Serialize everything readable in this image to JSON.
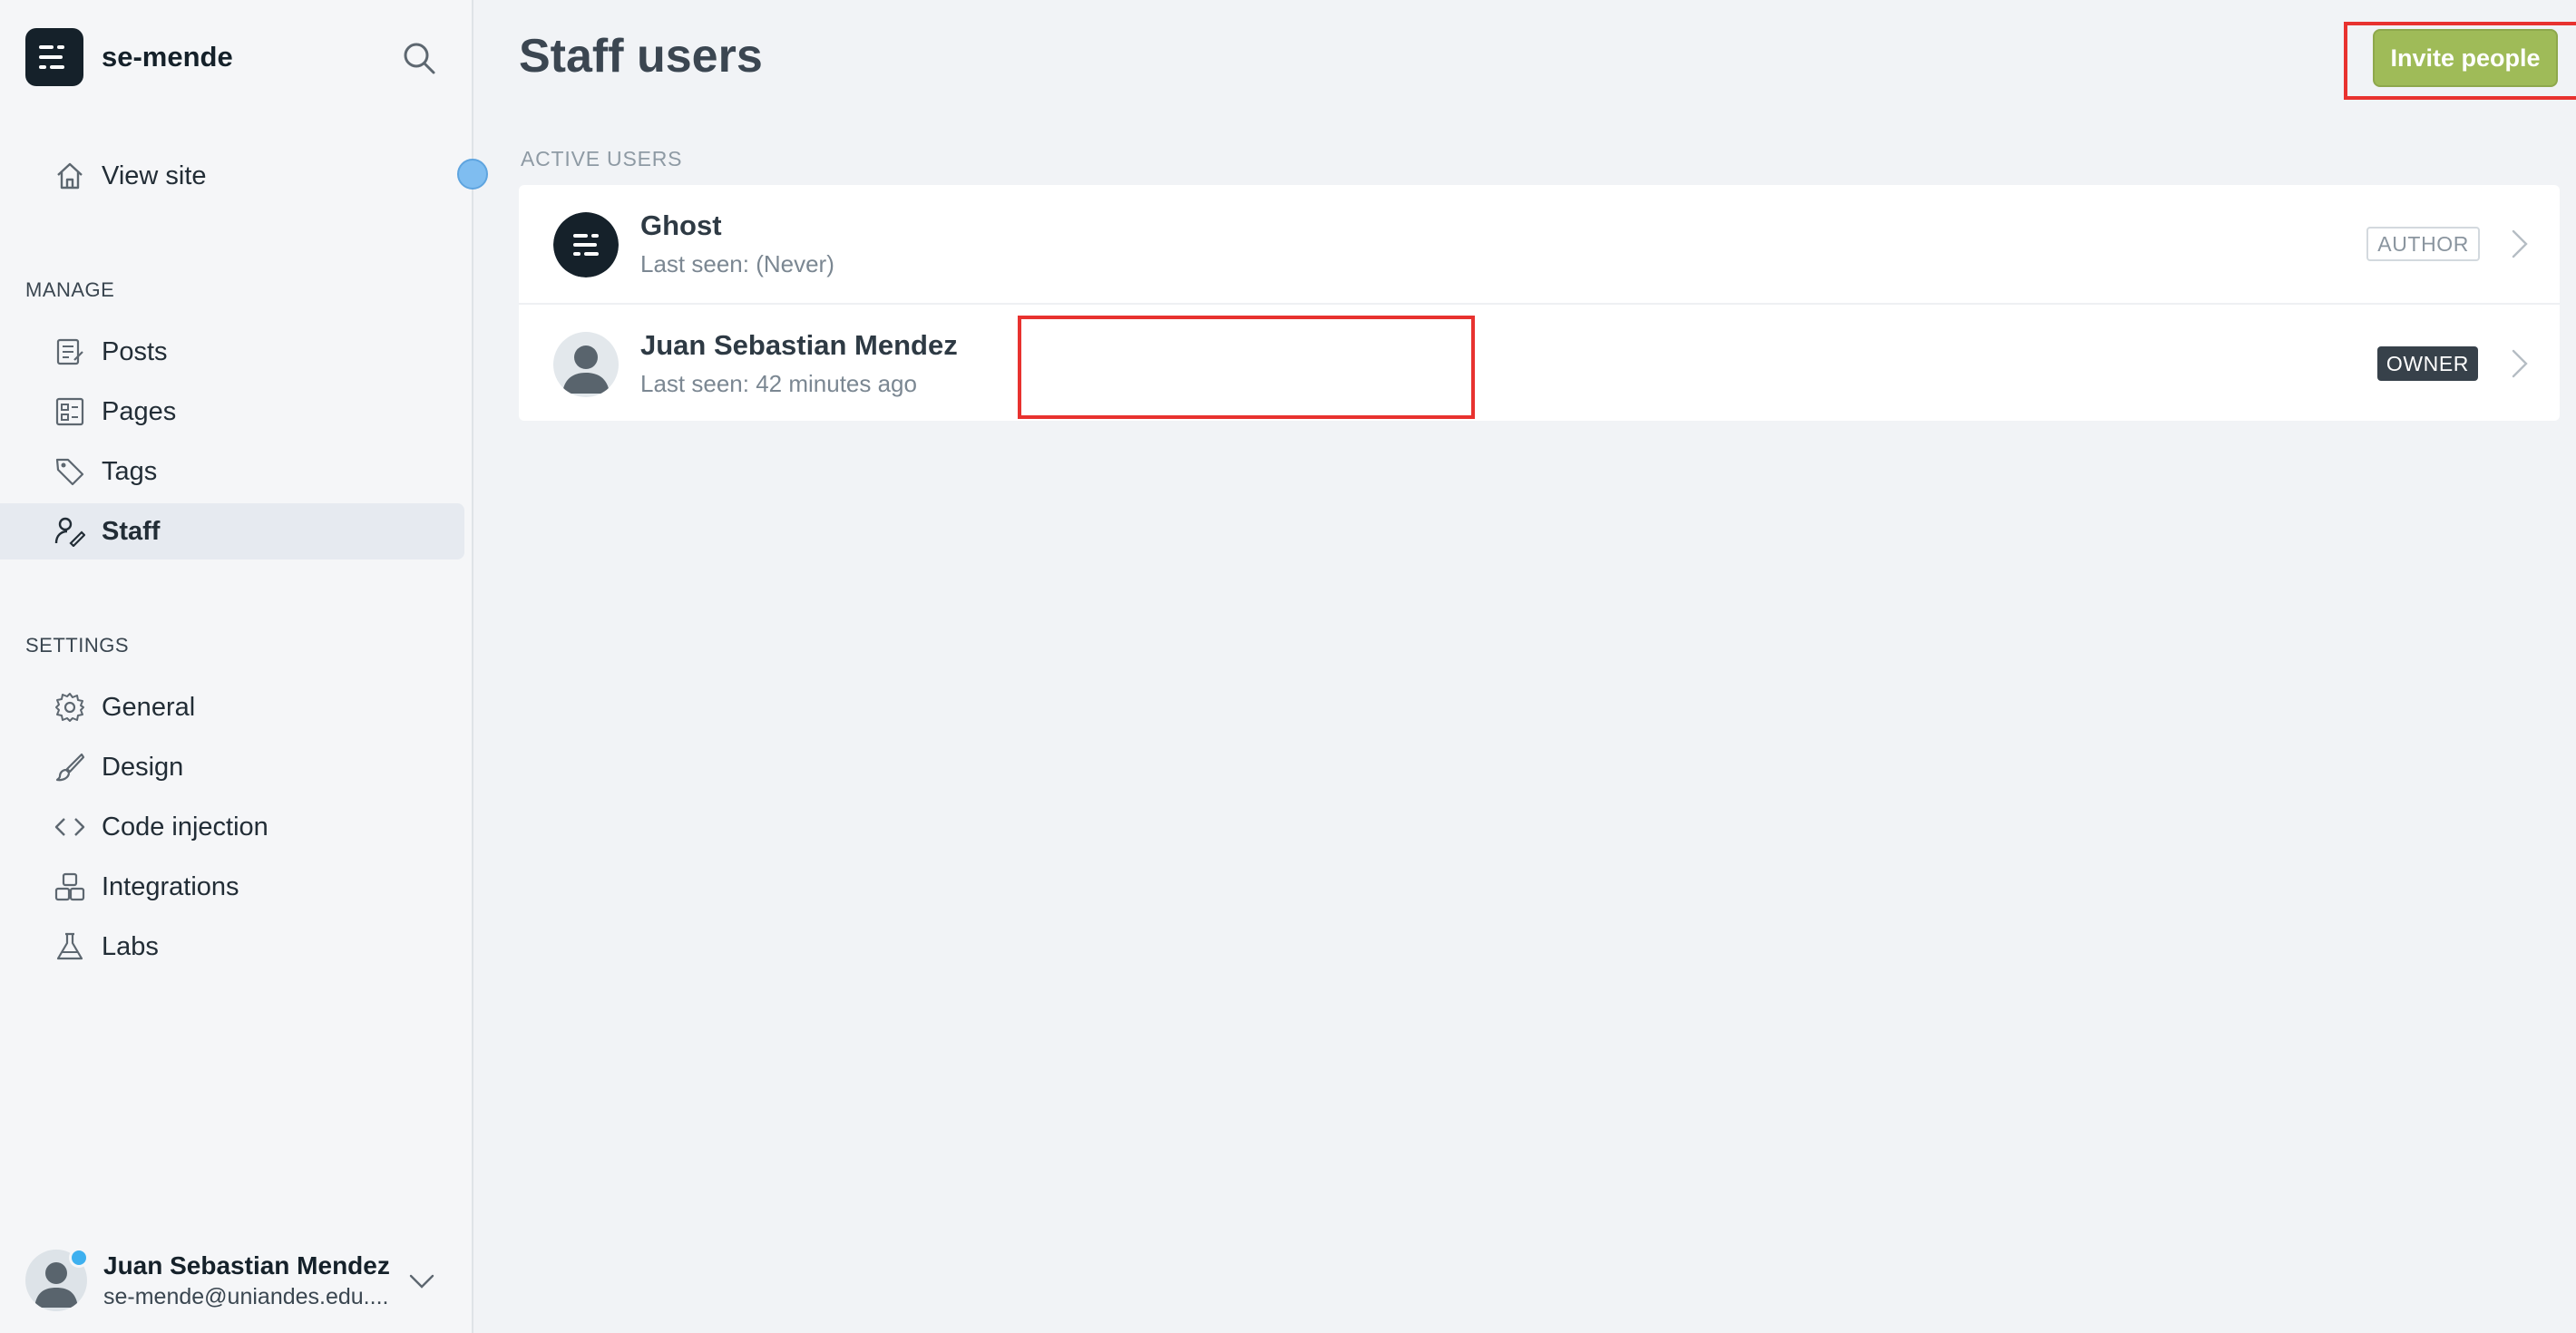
{
  "sidebar": {
    "brand_name": "se-mende",
    "view_site_label": "View site",
    "manage_title": "MANAGE",
    "manage_items": [
      {
        "label": "Posts",
        "icon": "posts-icon"
      },
      {
        "label": "Pages",
        "icon": "pages-icon"
      },
      {
        "label": "Tags",
        "icon": "tag-icon"
      },
      {
        "label": "Staff",
        "icon": "staff-icon",
        "active": true
      }
    ],
    "settings_title": "SETTINGS",
    "settings_items": [
      {
        "label": "General",
        "icon": "gear-icon"
      },
      {
        "label": "Design",
        "icon": "brush-icon"
      },
      {
        "label": "Code injection",
        "icon": "code-icon"
      },
      {
        "label": "Integrations",
        "icon": "integrations-icon"
      },
      {
        "label": "Labs",
        "icon": "flask-icon"
      }
    ],
    "current_user": {
      "name": "Juan Sebastian Mendez",
      "email": "se-mende@uniandes.edu...."
    }
  },
  "main": {
    "title": "Staff users",
    "invite_button_label": "Invite people",
    "list_heading": "ACTIVE USERS",
    "users": [
      {
        "name": "Ghost",
        "last_seen": "Last seen: (Never)",
        "role": "AUTHOR"
      },
      {
        "name": "Juan Sebastian Mendez",
        "last_seen": "Last seen: 42 minutes ago",
        "role": "OWNER"
      }
    ]
  },
  "colors": {
    "accent_green": "#9fbb58",
    "highlight_red": "#e8322f",
    "sidebar_bg": "#f5f6f8",
    "main_bg": "#f1f3f6",
    "online_blue": "#3eb0ef"
  }
}
